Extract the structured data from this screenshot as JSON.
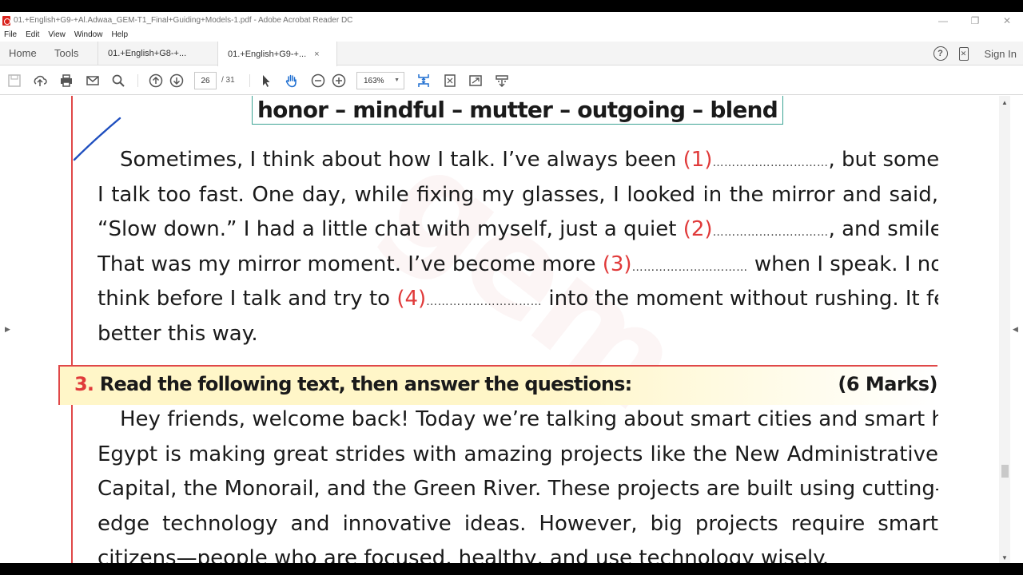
{
  "window": {
    "title": "01.+English+G9-+Al.Adwaa_GEM-T1_Final+Guiding+Models-1.pdf - Adobe Acrobat Reader DC"
  },
  "menu": [
    "File",
    "Edit",
    "View",
    "Window",
    "Help"
  ],
  "tabs": {
    "home": "Home",
    "tools": "Tools",
    "docs": [
      {
        "label": "01.+English+G8-+...",
        "active": false
      },
      {
        "label": "01.+English+G9-+...",
        "active": true,
        "close": "×"
      }
    ],
    "sign_in": "Sign In"
  },
  "toolbar": {
    "current_page": "26",
    "total_pages": "/ 31",
    "zoom": "163%",
    "icons": [
      "save-icon",
      "upload-icon",
      "print-icon",
      "email-icon",
      "search-icon",
      "page-up-icon",
      "page-down-icon",
      "select-cursor-icon",
      "hand-icon",
      "zoom-out-icon",
      "zoom-in-icon",
      "scroll-mode-icon",
      "fit-page-icon",
      "full-screen-icon",
      "read-mode-icon"
    ]
  },
  "document": {
    "word_bank": "honor – mindful – mutter – outgoing – blend",
    "paragraph1": [
      {
        "pre": "Sometimes, I think about how I talk. I’ve always been ",
        "num": "(1)",
        "dots": "…………………………",
        "post": ", but sometimes"
      },
      {
        "pre": "I talk too fast. One day, while fixing my glasses, I looked in the mirror and said,"
      },
      {
        "pre": "“Slow down.” I had a little chat with myself, just a quiet ",
        "num": "(2)",
        "dots": "…………………………",
        "post": ", and smiled."
      },
      {
        "pre": "That was my mirror moment. I’ve become more ",
        "num": "(3)",
        "dots": "…………………………",
        "post": " when I speak. I now"
      },
      {
        "pre": "think before I talk and try to ",
        "num": "(4)",
        "dots": "…………………………",
        "post": " into the moment without rushing. It feels"
      },
      {
        "pre": "better this way."
      }
    ],
    "section3": {
      "number": "3.",
      "title": "Read the following text, then answer the questions:",
      "marks": "(6 Marks)"
    },
    "paragraph2": [
      "Hey friends, welcome back! Today we’re talking about smart cities and smart habits.",
      "Egypt is making great strides with amazing projects like the New Administrative",
      "Capital, the Monorail, and the Green River. These projects are built using cutting-",
      "edge technology and innovative ideas. However, big projects require smart",
      "citizens—people who are focused, healthy, and use technology wisely."
    ]
  },
  "colors": {
    "accent_red": "#e03a3a",
    "wordbank_border": "#3ba394",
    "banner_bg": "#fff6c8",
    "pen_ink": "#1f4fbf"
  }
}
